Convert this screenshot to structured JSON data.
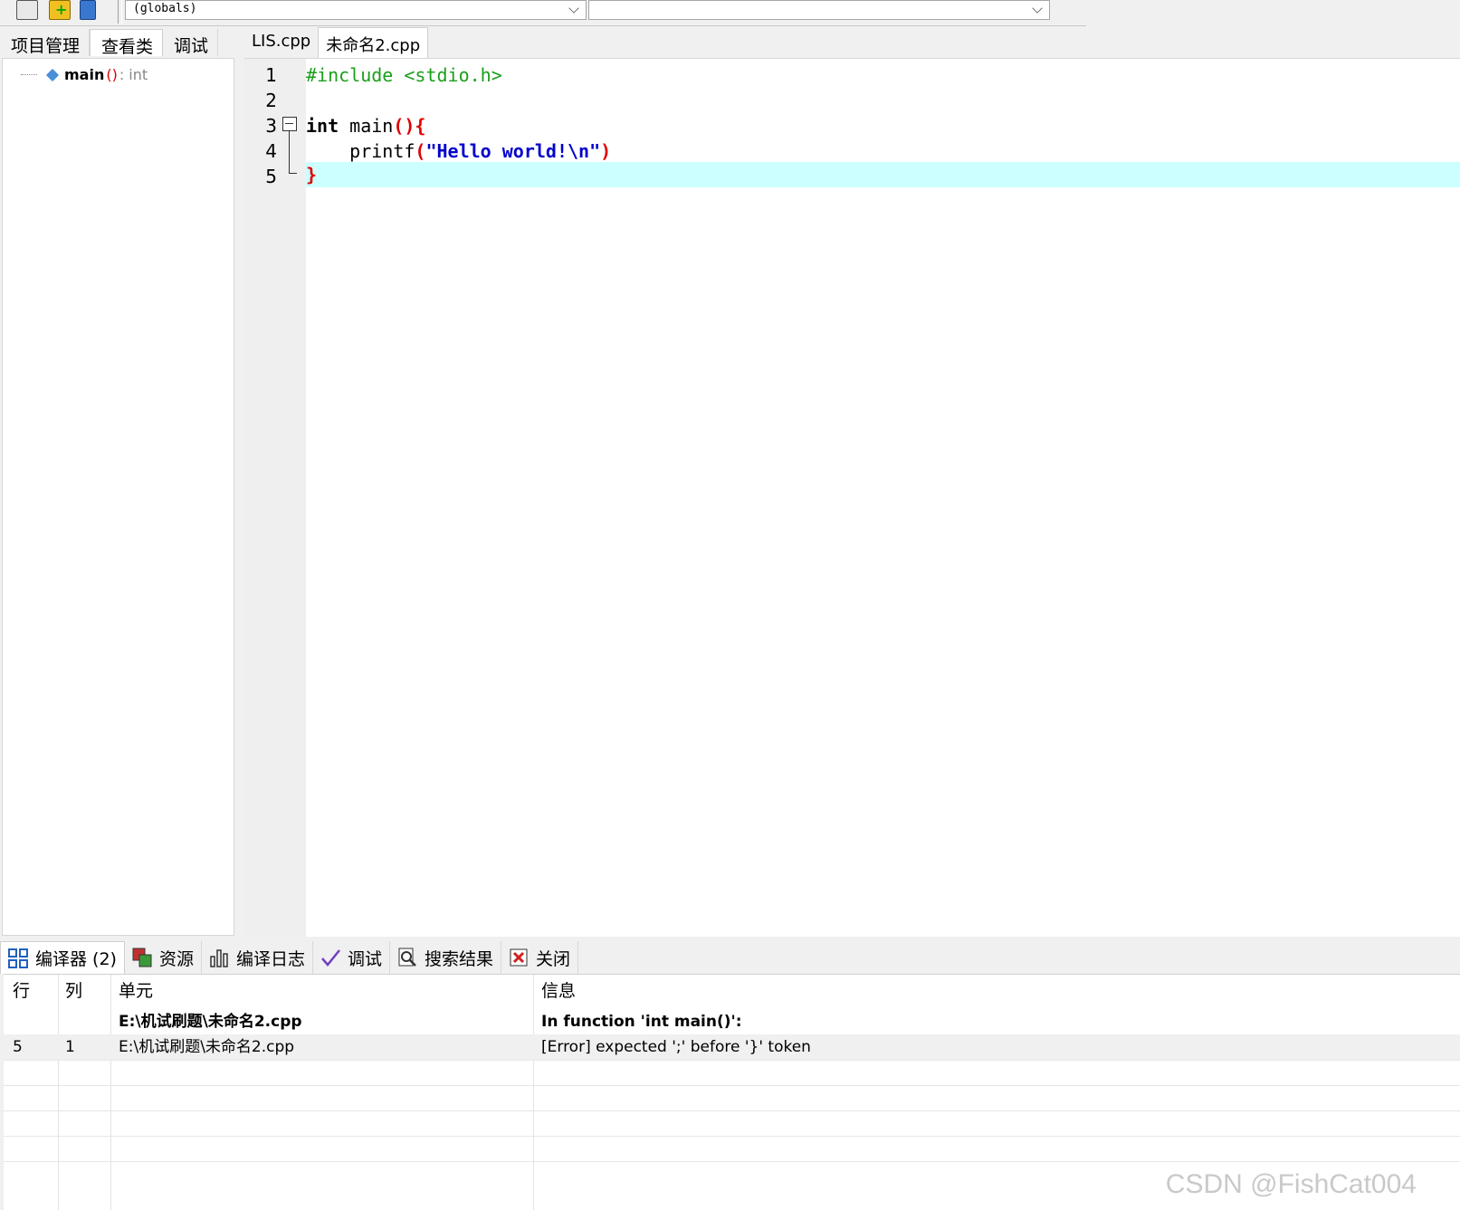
{
  "toolbar": {
    "scope_combo": "(globals)",
    "member_combo": ""
  },
  "left_tabs": [
    {
      "label": "项目管理"
    },
    {
      "label": "查看类"
    },
    {
      "label": "调试"
    }
  ],
  "class_tree": {
    "function_name": "main",
    "parens": "()",
    "return_type": ": int"
  },
  "editor_tabs": [
    {
      "label": "LIS.cpp"
    },
    {
      "label": "未命名2.cpp"
    }
  ],
  "editor": {
    "line_numbers": [
      "1",
      "2",
      "3",
      "4",
      "5"
    ],
    "line1": "#include <stdio.h>",
    "line3_kw": "int",
    "line3_fn": " main",
    "line3_paren": "(){",
    "line4_indent": "    printf",
    "line4_open": "(",
    "line4_str": "\"Hello world!\\n\"",
    "line4_close": ")",
    "line5": "}",
    "highlight_color": "#ccffff"
  },
  "bottom_tabs": [
    {
      "label": "编译器 (2)",
      "icon": "grid-icon"
    },
    {
      "label": "资源",
      "icon": "resources-icon"
    },
    {
      "label": "编译日志",
      "icon": "chart-icon"
    },
    {
      "label": "调试",
      "icon": "check-icon"
    },
    {
      "label": "搜索结果",
      "icon": "search-icon"
    },
    {
      "label": "关闭",
      "icon": "close-icon"
    }
  ],
  "results": {
    "headers": [
      "行",
      "列",
      "单元",
      "信息"
    ],
    "rows": [
      {
        "line": "",
        "col": "",
        "unit": "E:\\机试刷题\\未命名2.cpp",
        "message": "In function 'int main()':",
        "bold": true
      },
      {
        "line": "5",
        "col": "1",
        "unit": "E:\\机试刷题\\未命名2.cpp",
        "message": "[Error] expected ';' before '}' token",
        "bold": false
      }
    ]
  },
  "watermark": "CSDN @FishCat004"
}
